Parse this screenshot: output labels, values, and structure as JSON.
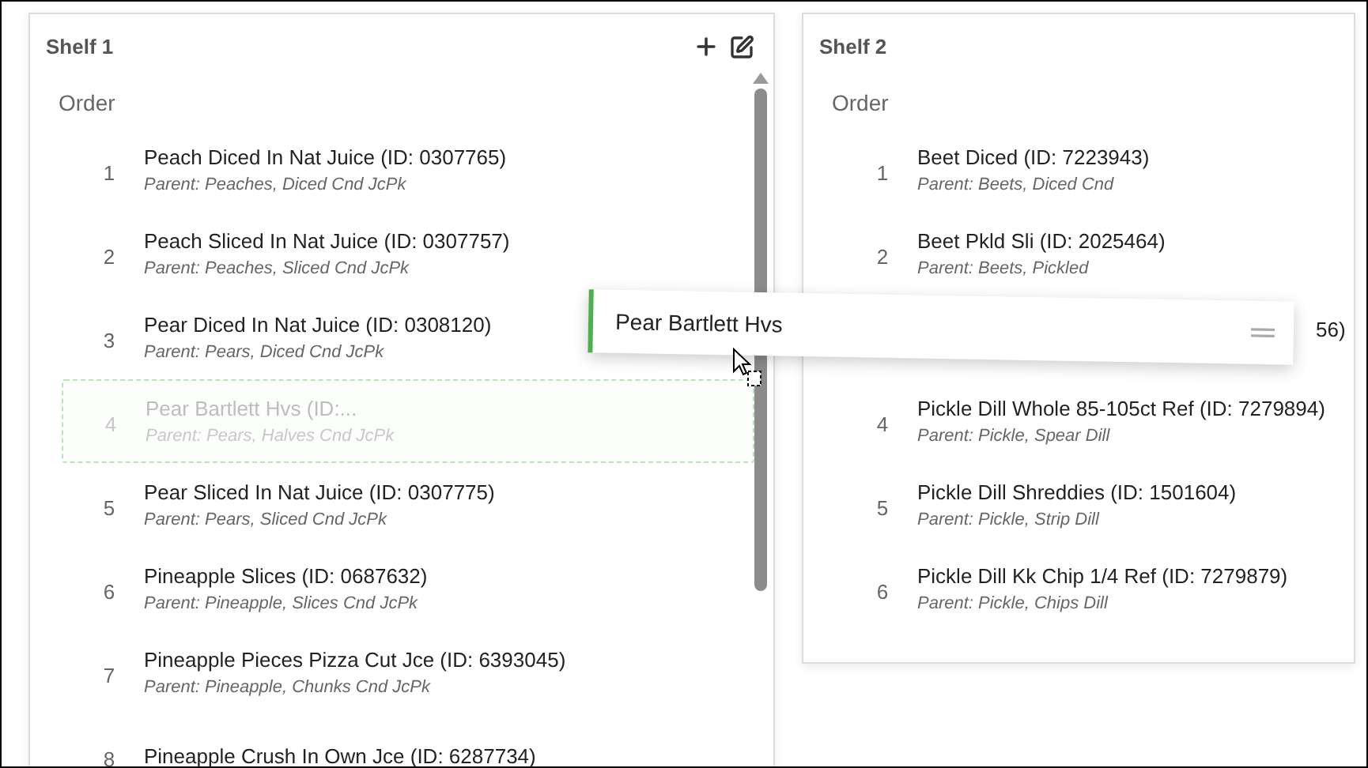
{
  "shelves": [
    {
      "title": "Shelf 1",
      "editable": true,
      "scrollable": true,
      "heading": "Order",
      "items": [
        {
          "kind": "item",
          "number": "1",
          "title": "Peach Diced In Nat Juice (ID: 0307765)",
          "parent": "Parent: Peaches, Diced Cnd JcPk"
        },
        {
          "kind": "item",
          "number": "2",
          "title": "Peach Sliced In Nat Juice (ID: 0307757)",
          "parent": "Parent: Peaches, Sliced Cnd JcPk"
        },
        {
          "kind": "item",
          "number": "3",
          "title": "Pear Diced In Nat Juice (ID: 0308120)",
          "parent": "Parent: Pears, Diced Cnd JcPk"
        },
        {
          "kind": "placeholder",
          "number": "4",
          "title": "Pear Bartlett Hvs (ID:...",
          "parent": "Parent: Pears, Halves Cnd JcPk"
        },
        {
          "kind": "item",
          "number": "5",
          "title": "Pear Sliced In Nat Juice (ID: 0307775)",
          "parent": "Parent: Pears, Sliced Cnd JcPk"
        },
        {
          "kind": "item",
          "number": "6",
          "title": "Pineapple Slices (ID: 0687632)",
          "parent": "Parent: Pineapple, Slices Cnd JcPk"
        },
        {
          "kind": "item",
          "number": "7",
          "title": "Pineapple Pieces Pizza Cut Jce (ID: 6393045)",
          "parent": "Parent: Pineapple, Chunks Cnd JcPk"
        },
        {
          "kind": "item",
          "number": "8",
          "title": "Pineapple Crush In Own Jce (ID: 6287734)"
        }
      ]
    },
    {
      "title": "Shelf 2",
      "editable": false,
      "scrollable": false,
      "heading": "Order",
      "items": [
        {
          "kind": "item",
          "number": "1",
          "title": "Beet Diced (ID: 7223943)",
          "parent": "Parent: Beets, Diced Cnd"
        },
        {
          "kind": "item",
          "number": "2",
          "title": "Beet Pkld Sli (ID: 2025464)",
          "parent": "Parent: Beets, Pickled"
        },
        {
          "kind": "covered",
          "title": "56)"
        },
        {
          "kind": "item",
          "number": "4",
          "title": "Pickle Dill Whole 85-105ct Ref (ID: 7279894)",
          "parent": "Parent: Pickle, Spear Dill"
        },
        {
          "kind": "item",
          "number": "5",
          "title": "Pickle Dill Shreddies (ID: 1501604)",
          "parent": "Parent: Pickle, Strip Dill"
        },
        {
          "kind": "item",
          "number": "6",
          "title": "Pickle Dill Kk Chip 1/4 Ref (ID: 7279879)",
          "parent": "Parent: Pickle, Chips Dill"
        }
      ]
    }
  ],
  "drag_preview": {
    "title": "Pear Bartlett Hvs"
  }
}
